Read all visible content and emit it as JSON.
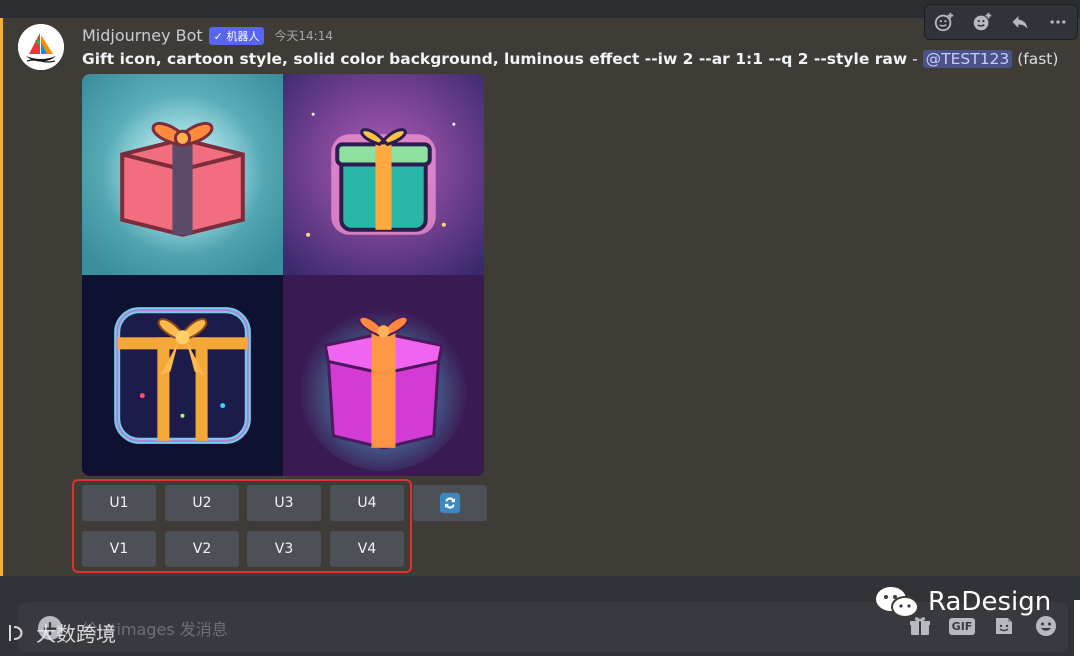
{
  "message": {
    "username": "Midjourney Bot",
    "bot_badge": "✓ 机器人",
    "timestamp": "今天14:14",
    "prompt": "Gift icon, cartoon style, solid color background, luminous effect --iw 2 --ar 1:1 --q 2 --style raw",
    "separator": " - ",
    "mention": "@TEST123",
    "speed": "(fast)"
  },
  "buttons": {
    "upscale": [
      "U1",
      "U2",
      "U3",
      "U4"
    ],
    "variation": [
      "V1",
      "V2",
      "V3",
      "V4"
    ]
  },
  "input": {
    "placeholder": "给 #images 发消息"
  },
  "input_icons": [
    "gift-icon",
    "gif-icon",
    "sticker-icon",
    "emoji-icon"
  ],
  "input_gif_label": "GIF",
  "watermarks": {
    "left": "大数跨境",
    "right": "RaDesign"
  },
  "colors": {
    "accent": "#5865f2",
    "highlight_bar": "#f0b232",
    "annotation_box": "#e0312c"
  }
}
